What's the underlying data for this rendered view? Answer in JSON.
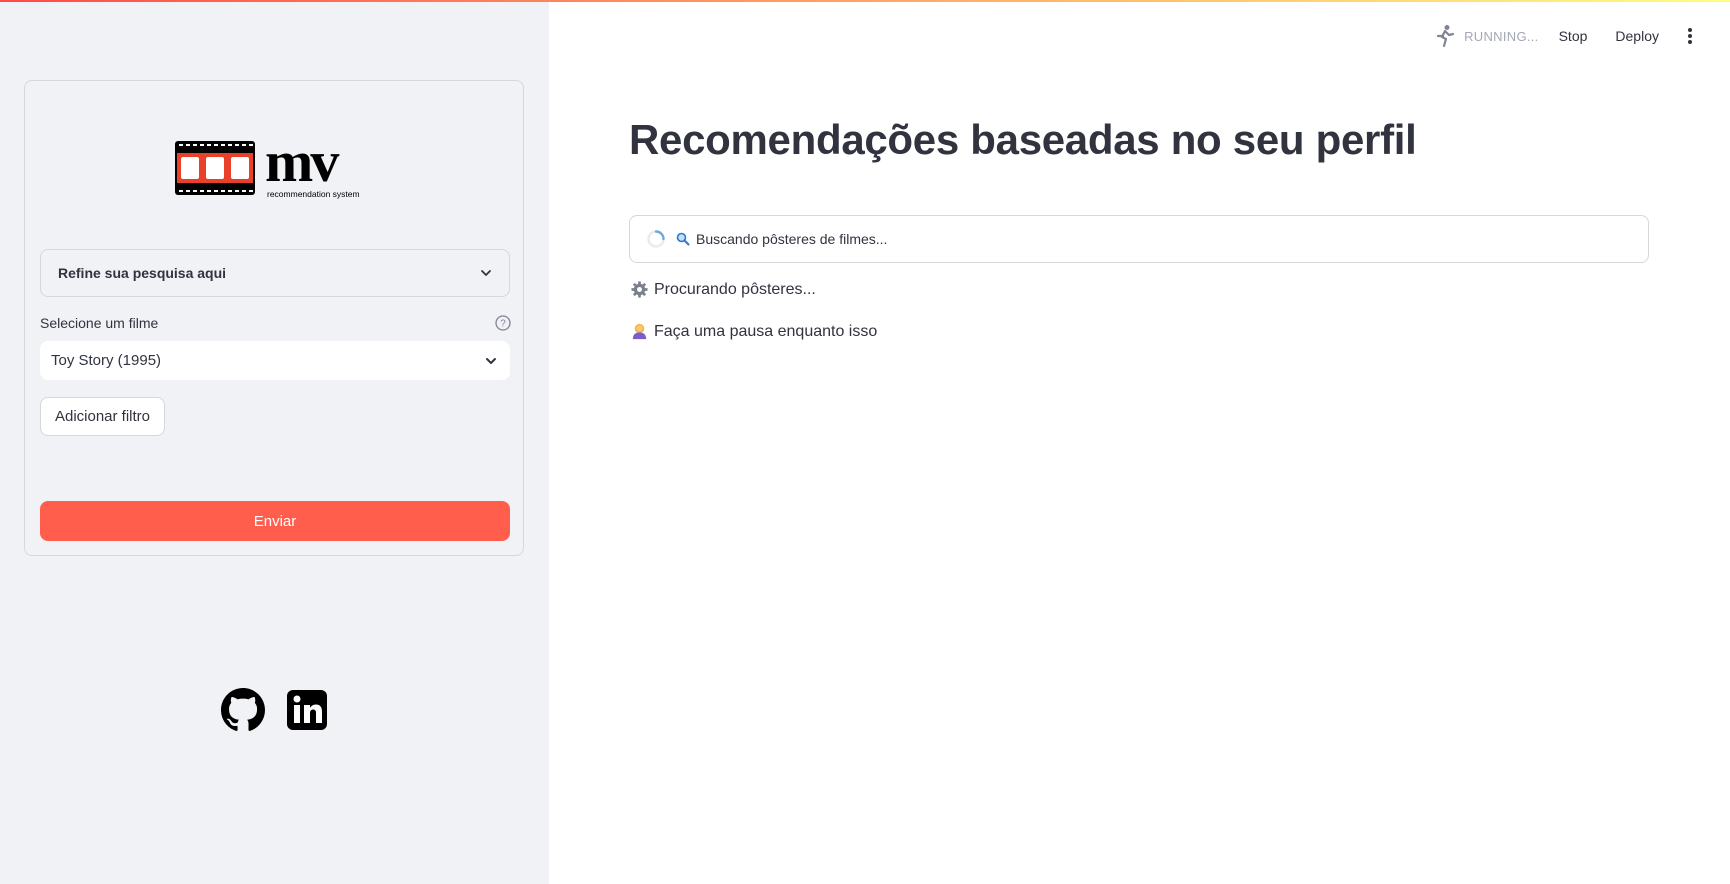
{
  "app": {
    "title": "Recomendações baseadas no seu perfil",
    "accent_color": "#ff4b4b",
    "logo": {
      "text": "mv",
      "tagline": "recommendation system"
    }
  },
  "header": {
    "status_text": "RUNNING...",
    "status_icon": "running-man-icon",
    "stop_label": "Stop",
    "deploy_label": "Deploy",
    "menu_icon": "kebab-menu-icon"
  },
  "sidebar": {
    "expander_label": "Refine sua pesquisa aqui",
    "select_label": "Selecione um filme",
    "select_value": "Toy Story (1995)",
    "add_filter_label": "Adicionar filtro",
    "submit_label": "Enviar",
    "submit_color": "#ff5e4d",
    "social_icons": [
      "github-icon",
      "linkedin-icon"
    ]
  },
  "main": {
    "status_box_text": "Buscando pôsteres de filmes...",
    "messages": [
      {
        "icon": "gear-icon",
        "text": "Procurando pôsteres..."
      },
      {
        "icon": "meditation-icon",
        "text": "Faça uma pausa enquanto isso"
      }
    ]
  }
}
